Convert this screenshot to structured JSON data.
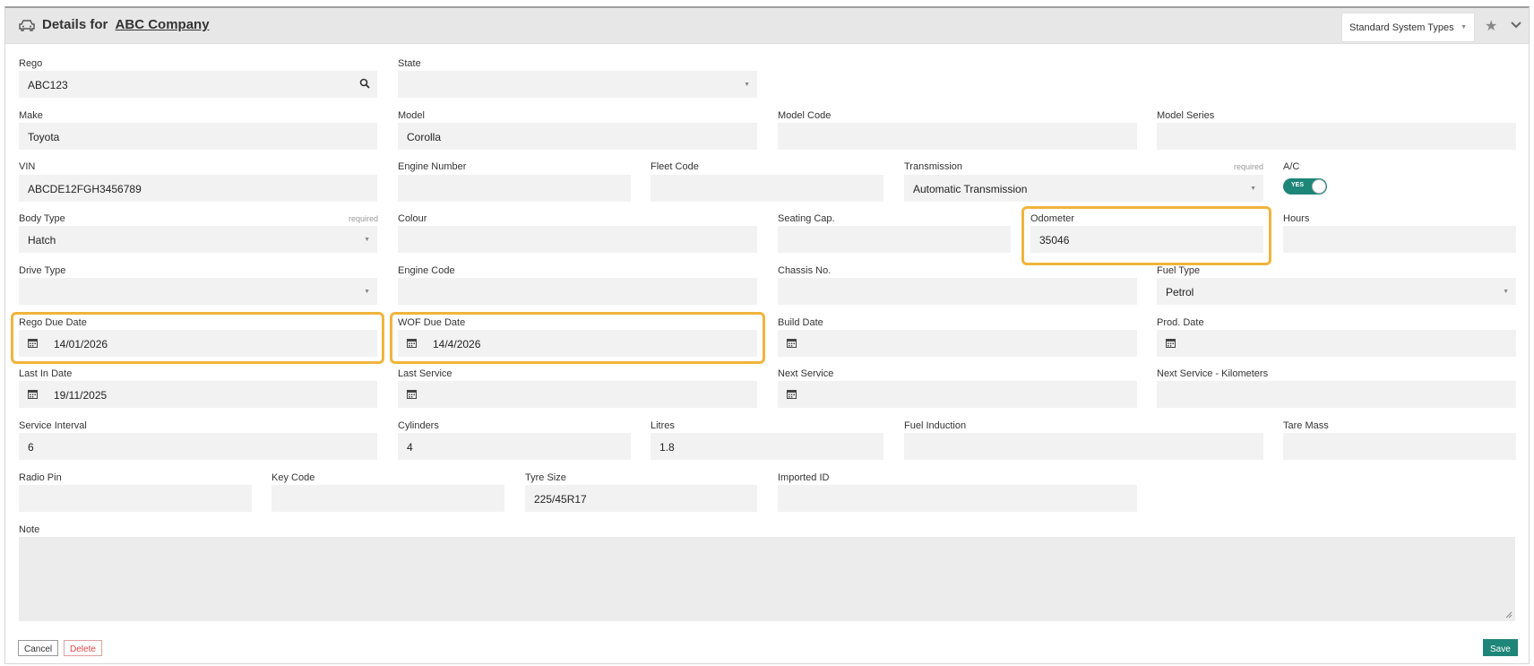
{
  "header": {
    "title_prefix": "Details for",
    "company": "ABC Company",
    "types_select": "Standard System Types"
  },
  "labels": {
    "rego": "Rego",
    "state": "State",
    "make": "Make",
    "model": "Model",
    "model_code": "Model Code",
    "model_series": "Model Series",
    "vin": "VIN",
    "engine_number": "Engine Number",
    "fleet_code": "Fleet Code",
    "transmission": "Transmission",
    "ac": "A/C",
    "body_type": "Body Type",
    "colour": "Colour",
    "seating_cap": "Seating Cap.",
    "odometer": "Odometer",
    "hours": "Hours",
    "drive_type": "Drive Type",
    "engine_code": "Engine Code",
    "chassis_no": "Chassis No.",
    "fuel_type": "Fuel Type",
    "rego_due_date": "Rego Due Date",
    "wof_due_date": "WOF Due Date",
    "build_date": "Build Date",
    "prod_date": "Prod. Date",
    "last_in_date": "Last In Date",
    "last_service": "Last Service",
    "next_service": "Next Service",
    "next_service_km": "Next Service - Kilometers",
    "service_interval": "Service Interval",
    "cylinders": "Cylinders",
    "litres": "Litres",
    "fuel_induction": "Fuel Induction",
    "tare_mass": "Tare Mass",
    "radio_pin": "Radio Pin",
    "key_code": "Key Code",
    "tyre_size": "Tyre Size",
    "imported_id": "Imported ID",
    "note": "Note",
    "required": "required"
  },
  "values": {
    "rego": "ABC123",
    "make": "Toyota",
    "model": "Corolla",
    "vin": "ABCDE12FGH3456789",
    "transmission": "Automatic Transmission",
    "ac_toggle": "YES",
    "body_type": "Hatch",
    "odometer": "35046",
    "fuel_type": "Petrol",
    "rego_due_date": "14/01/2026",
    "wof_due_date": "14/4/2026",
    "last_in_date": "19/11/2025",
    "service_interval": "6",
    "cylinders": "4",
    "litres": "1.8",
    "tyre_size": "225/45R17"
  },
  "buttons": {
    "cancel": "Cancel",
    "delete": "Delete",
    "save": "Save"
  },
  "colors": {
    "accent": "#1e8579",
    "highlight": "#f0b43c",
    "delete": "#e04545"
  }
}
